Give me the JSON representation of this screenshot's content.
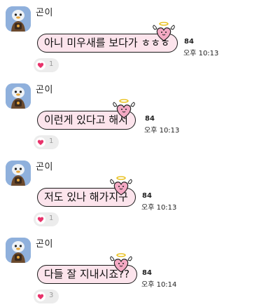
{
  "colors": {
    "bubble_fill": "#fce4ec",
    "bubble_border": "#1a1a1a",
    "avatar_bg": "#8fb0dc",
    "heart": "#e8336b",
    "reaction_bg": "#ececec"
  },
  "messages": [
    {
      "sender": "곤이",
      "text": "아니 미우새를 보다가 ㅎㅎㅎ",
      "unread": "84",
      "time": "오후 10:13",
      "reaction_icon": "heart-icon",
      "reaction_count": "1"
    },
    {
      "sender": "곤이",
      "text": "이런게 있다고 해서",
      "unread": "84",
      "time": "오후 10:13",
      "reaction_icon": "heart-icon",
      "reaction_count": "1"
    },
    {
      "sender": "곤이",
      "text": "저도 있나 해가지구",
      "unread": "84",
      "time": "오후 10:13",
      "reaction_icon": "heart-icon",
      "reaction_count": "1"
    },
    {
      "sender": "곤이",
      "text": "다들 잘 지내시죠??",
      "unread": "84",
      "time": "오후 10:14",
      "reaction_icon": "heart-icon",
      "reaction_count": "3"
    }
  ]
}
